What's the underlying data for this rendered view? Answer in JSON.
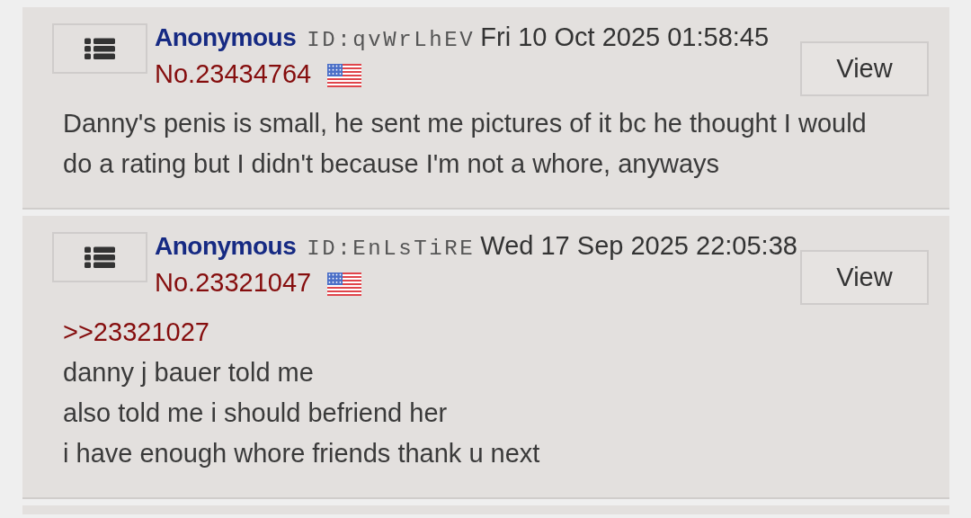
{
  "posts": [
    {
      "name": "Anonymous",
      "id_label": "ID:",
      "id": "qvWrLhEV",
      "date": "Fri 10 Oct 2025 01:58:45",
      "number": "No.23434764",
      "view_button": "View",
      "lines": [
        {
          "kind": "text",
          "text": "Danny's penis is small, he sent me pictures of it bc he thought I would do a rating but I didn't because I'm not a whore, anyways"
        }
      ]
    },
    {
      "name": "Anonymous",
      "id_label": "ID:",
      "id": "EnLsTiRE",
      "date": "Wed 17 Sep 2025 22:05:38",
      "number": "No.23321047",
      "view_button": "View",
      "lines": [
        {
          "kind": "quote",
          "text": ">>23321027"
        },
        {
          "kind": "text",
          "text": "danny j bauer told me"
        },
        {
          "kind": "text",
          "text": "also told me i should befriend her"
        },
        {
          "kind": "text",
          "text": "i have enough whore friends thank u next"
        }
      ]
    }
  ]
}
